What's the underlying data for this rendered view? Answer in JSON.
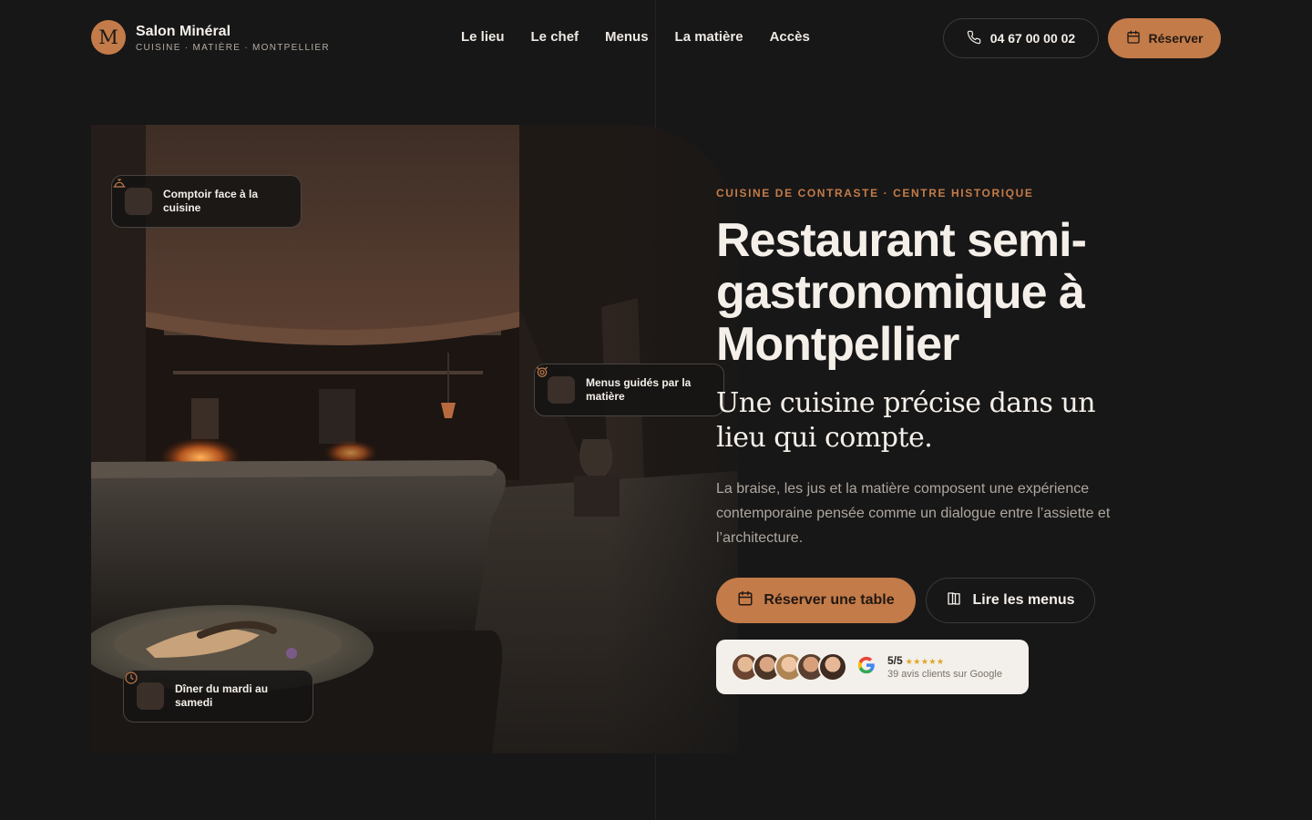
{
  "brand": {
    "monogram": "M",
    "name": "Salon Minéral",
    "tagline": "CUISINE · MATIÈRE · MONTPELLIER",
    "accent_color": "#c37b49"
  },
  "nav": {
    "items": [
      {
        "label": "Le lieu"
      },
      {
        "label": "Le chef"
      },
      {
        "label": "Menus"
      },
      {
        "label": "La matière"
      },
      {
        "label": "Accès"
      }
    ]
  },
  "header": {
    "phone": "04 67 00 00 02",
    "phone_icon": "phone-icon",
    "reserve_label": "Réserver",
    "reserve_icon": "calendar-icon"
  },
  "hero": {
    "badges": [
      {
        "text": "Comptoir face à la cuisine",
        "icon": "service-bell-icon"
      },
      {
        "text": "Menus guidés par la matière",
        "icon": "bowl-icon"
      },
      {
        "text": "Dîner du mardi au samedi",
        "icon": "clock-icon"
      }
    ],
    "eyebrow": "CUISINE DE CONTRASTE · CENTRE HISTORIQUE",
    "title": "Restaurant semi-gastronomique à Montpellier",
    "subtitle": "Une cuisine précise dans un lieu qui compte.",
    "description": "La braise, les jus et la matière composent une expérience contemporaine pensée comme un dialogue entre l’assiette et l’architecture.",
    "cta_primary": "Réserver une table",
    "cta_primary_icon": "calendar-icon",
    "cta_secondary": "Lire les menus",
    "cta_secondary_icon": "book-icon"
  },
  "reviews": {
    "rating": "5/5",
    "stars": "★★★★★",
    "count_text": "39 avis clients sur Google",
    "source_icon": "google-icon",
    "avatar_count": 5
  }
}
